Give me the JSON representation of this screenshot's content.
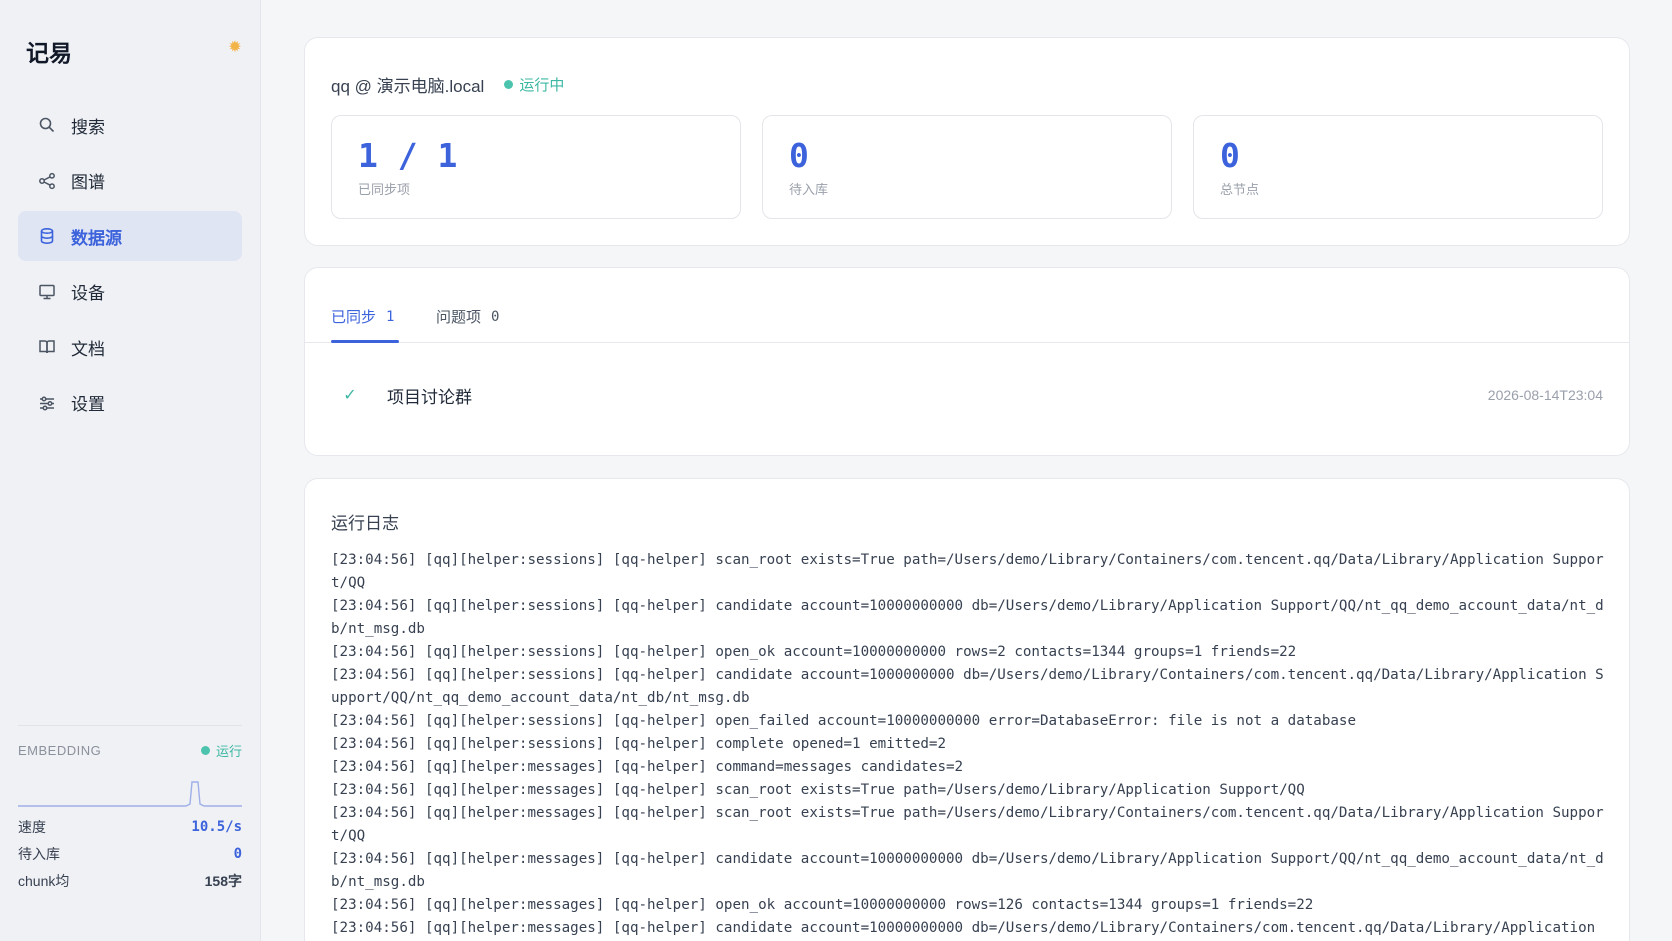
{
  "app": {
    "title": "记易",
    "theme_icon": "sun-icon"
  },
  "sidebar": {
    "items": [
      {
        "label": "搜索",
        "icon": "search-icon",
        "active": false
      },
      {
        "label": "图谱",
        "icon": "share-icon",
        "active": false
      },
      {
        "label": "数据源",
        "icon": "database-icon",
        "active": true
      },
      {
        "label": "设备",
        "icon": "monitor-icon",
        "active": false
      },
      {
        "label": "文档",
        "icon": "book-icon",
        "active": false
      },
      {
        "label": "设置",
        "icon": "sliders-icon",
        "active": false
      }
    ],
    "embedding": {
      "title": "EMBEDDING",
      "status": "运行",
      "stats": [
        {
          "label": "速度",
          "value": "10.5/s"
        },
        {
          "label": "待入库",
          "value": "0"
        },
        {
          "label": "chunk均",
          "value": "158字"
        }
      ]
    }
  },
  "source": {
    "host": "qq @ 演示电脑.local",
    "status": "运行中",
    "metrics": [
      {
        "value": "1 / 1",
        "label": "已同步项"
      },
      {
        "value": "0",
        "label": "待入库"
      },
      {
        "value": "0",
        "label": "总节点"
      }
    ]
  },
  "tabs": [
    {
      "label": "已同步",
      "count": "1"
    },
    {
      "label": "问题项",
      "count": "0"
    }
  ],
  "synced": [
    {
      "name": "项目讨论群",
      "time": "2026-08-14T23:04"
    }
  ],
  "log": {
    "title": "运行日志",
    "lines": [
      "[23:04:56] [qq][helper:sessions] [qq-helper] scan_root exists=True path=/Users/demo/Library/Containers/com.tencent.qq/Data/Library/Application Support/QQ",
      "[23:04:56] [qq][helper:sessions] [qq-helper] candidate account=10000000000 db=/Users/demo/Library/Application Support/QQ/nt_qq_demo_account_data/nt_db/nt_msg.db",
      "[23:04:56] [qq][helper:sessions] [qq-helper] open_ok account=10000000000 rows=2 contacts=1344 groups=1 friends=22",
      "[23:04:56] [qq][helper:sessions] [qq-helper] candidate account=1000000000 db=/Users/demo/Library/Containers/com.tencent.qq/Data/Library/Application Support/QQ/nt_qq_demo_account_data/nt_db/nt_msg.db",
      "[23:04:56] [qq][helper:sessions] [qq-helper] open_failed account=10000000000 error=DatabaseError: file is not a database",
      "[23:04:56] [qq][helper:sessions] [qq-helper] complete opened=1 emitted=2",
      "[23:04:56] [qq][helper:messages] [qq-helper] command=messages candidates=2",
      "[23:04:56] [qq][helper:messages] [qq-helper] scan_root exists=True path=/Users/demo/Library/Application Support/QQ",
      "[23:04:56] [qq][helper:messages] [qq-helper] scan_root exists=True path=/Users/demo/Library/Containers/com.tencent.qq/Data/Library/Application Support/QQ",
      "[23:04:56] [qq][helper:messages] [qq-helper] candidate account=10000000000 db=/Users/demo/Library/Application Support/QQ/nt_qq_demo_account_data/nt_db/nt_msg.db",
      "[23:04:56] [qq][helper:messages] [qq-helper] open_ok account=10000000000 rows=126 contacts=1344 groups=1 friends=22",
      "[23:04:56] [qq][helper:messages] [qq-helper] candidate account=10000000000 db=/Users/demo/Library/Containers/com.tencent.qq/Data/Library/Application"
    ]
  }
}
